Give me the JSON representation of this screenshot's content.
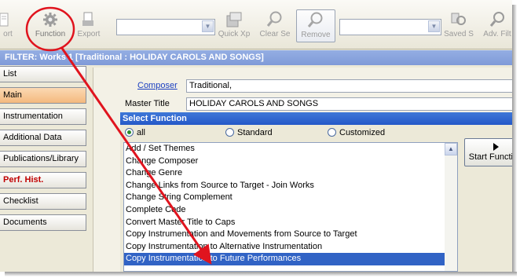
{
  "toolbar": {
    "buttons": [
      {
        "label": "ort"
      },
      {
        "label": "Function"
      },
      {
        "label": "Export"
      },
      {
        "label": "Quick Xp"
      },
      {
        "label": "Clear Se"
      },
      {
        "label": "Remove"
      },
      {
        "label": "Saved S"
      },
      {
        "label": "Adv. Filt"
      }
    ]
  },
  "filter_bar": {
    "text": "FILTER: Works 1 [Traditional : HOLIDAY CAROLS AND SONGS]"
  },
  "nav": {
    "items": [
      {
        "label": "List"
      },
      {
        "label": "Main"
      },
      {
        "label": "Instrumentation"
      },
      {
        "label": "Additional Data"
      },
      {
        "label": "Publications/Library"
      },
      {
        "label": "Perf. Hist."
      },
      {
        "label": "Checklist"
      },
      {
        "label": "Documents"
      }
    ]
  },
  "main": {
    "composer_label": "Composer",
    "composer_value": "Traditional,",
    "master_title_label": "Master Title",
    "master_title_value": "HOLIDAY CAROLS AND SONGS"
  },
  "dialog": {
    "title": "Select Function",
    "radios": [
      {
        "label": "all",
        "checked": true
      },
      {
        "label": "Standard",
        "checked": false
      },
      {
        "label": "Customized",
        "checked": false
      }
    ],
    "functions": [
      "Add / Set Themes",
      "Change Composer",
      "Change Genre",
      "Change Links from Source to Target - Join Works",
      "Change String Complement",
      "Complete Code",
      "Convert Master Title to Caps",
      "Copy Instrumentation and Movements from Source to Target",
      "Copy Instrumentation to Alternative Instrumentation",
      "Copy Instrumentation to Future Performances"
    ],
    "selected_index": 9,
    "start_label": "Start Function"
  },
  "colors": {
    "selection": "#3163c5",
    "title_bar": "#2458c8",
    "filter_bar": "#8aa4de",
    "annotation": "#e0141e",
    "nav_selected": "#f4b97e"
  }
}
